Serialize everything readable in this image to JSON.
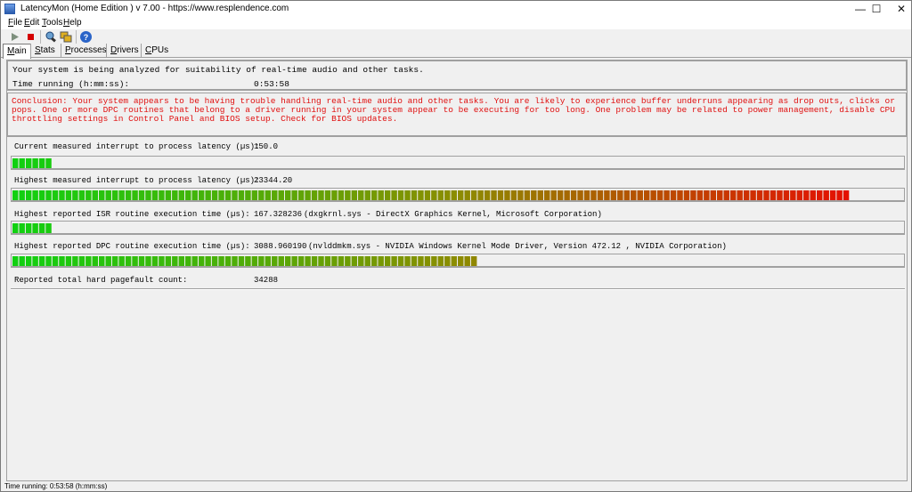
{
  "window": {
    "title": "LatencyMon  (Home Edition )  v 7.00 - https://www.resplendence.com",
    "minimize_glyph": "—",
    "maximize_glyph": "☐",
    "close_glyph": "✕"
  },
  "menu": {
    "file": {
      "key": "F",
      "rest": "ile"
    },
    "edit": {
      "key": "E",
      "rest": "dit"
    },
    "tools": {
      "key": "T",
      "rest": "ools"
    },
    "help": {
      "key": "H",
      "rest": "elp"
    }
  },
  "toolbar": {
    "icons": [
      "play-icon",
      "stop-icon",
      "analyze-icon",
      "windows-icon",
      "help-icon"
    ],
    "colors": {
      "play": "#7d8f7d",
      "stop": "#d40000",
      "help": "#2a64c8"
    }
  },
  "tabs": [
    {
      "key": "M",
      "rest": "ain"
    },
    {
      "key": "S",
      "rest": "tats"
    },
    {
      "key": "P",
      "rest": "rocesses"
    },
    {
      "key": "D",
      "rest": "rivers"
    },
    {
      "key": "C",
      "rest": "PUs"
    }
  ],
  "analysis": {
    "status_text": "Your system is being analyzed for suitability of real-time audio and other tasks.",
    "time_running_label": "Time running (h:mm:ss):",
    "time_running_value": "0:53:58"
  },
  "conclusion": {
    "text": "Conclusion: Your system appears to be having trouble handling real-time audio and other tasks. You are likely to experience buffer underruns appearing as drop outs, clicks or pops. One or more DPC routines that belong to a driver running in your system appear to be executing for too long. One problem may be related to power management, disable CPU throttling settings in Control Panel and BIOS setup. Check for BIOS updates.",
    "color": "#e01010"
  },
  "metrics": [
    {
      "label": "Current measured interrupt to process latency (µs):",
      "value": "150.0",
      "detail": "",
      "bar_segments": 6
    },
    {
      "label": "Highest measured interrupt to process latency (µs):",
      "value": "23344.20",
      "detail": "",
      "bar_segments": 126
    },
    {
      "label": "Highest reported ISR routine execution time (µs):",
      "value": "167.328236",
      "detail": "(dxgkrnl.sys - DirectX Graphics Kernel, Microsoft Corporation)",
      "bar_segments": 6
    },
    {
      "label": "Highest reported DPC routine execution time (µs):",
      "value": "3088.960190",
      "detail": "(nvlddmkm.sys - NVIDIA Windows Kernel Mode Driver, Version 472.12 , NVIDIA Corporation)",
      "bar_segments": 70
    }
  ],
  "pagefault": {
    "label": "Reported total hard pagefault count:",
    "value": "34288"
  },
  "bar_scale_segments": 134,
  "bar_colors": {
    "green": "#10d010",
    "olive": "#8c8c00",
    "red": "#f00000"
  },
  "status_bar": "Time running: 0:53:58  (h:mm:ss)"
}
